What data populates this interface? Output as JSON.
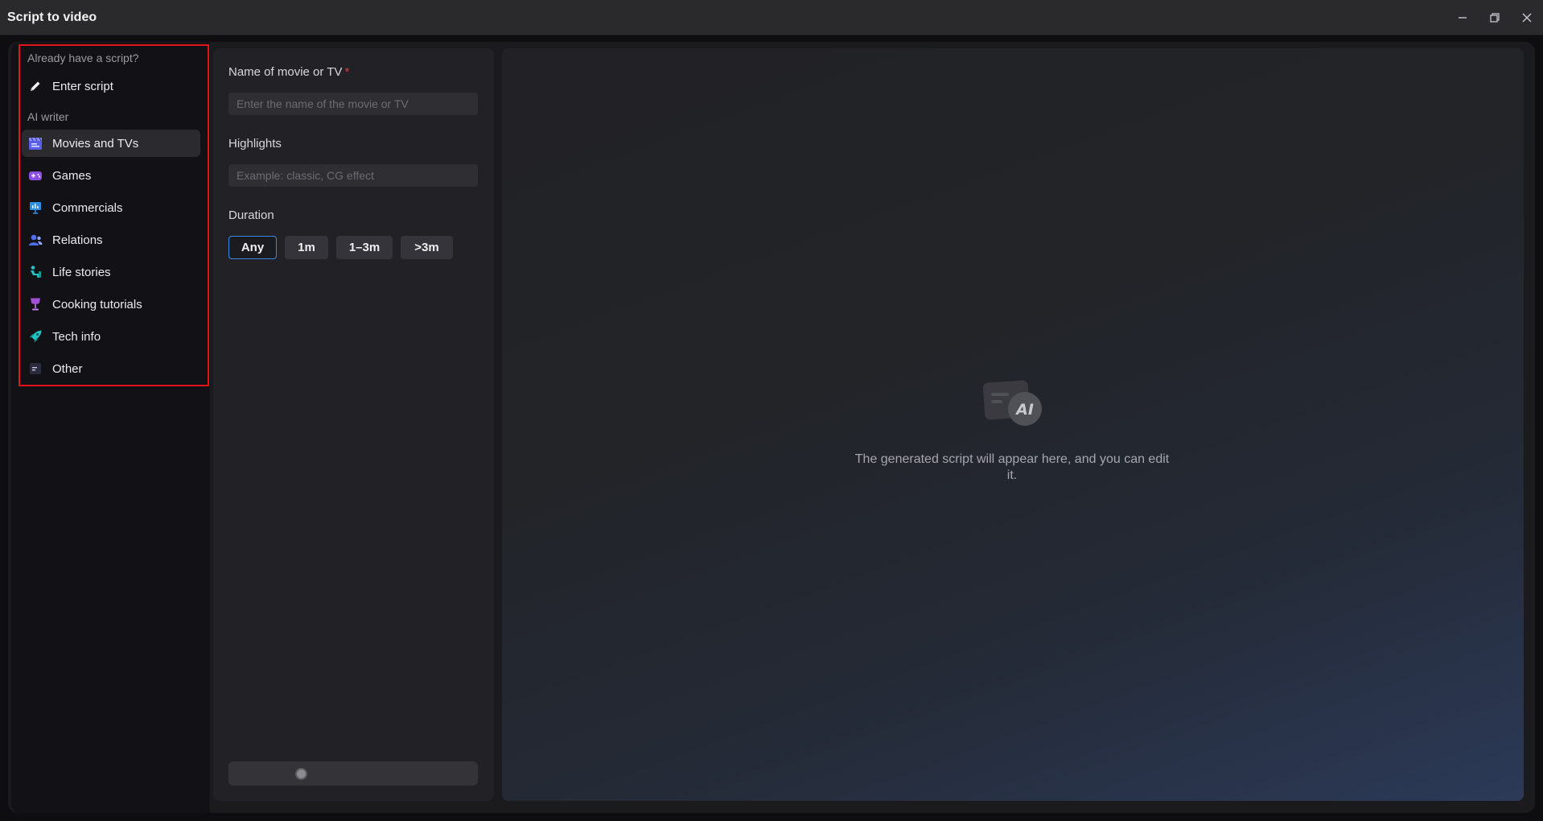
{
  "window": {
    "title": "Script to video",
    "controls": [
      "minimize-icon",
      "restore-icon",
      "close-icon"
    ]
  },
  "sidebar": {
    "section_existing": "Already have a script?",
    "enter_script": {
      "label": "Enter script",
      "icon": "pencil-icon"
    },
    "section_ai": "AI writer",
    "items": [
      {
        "label": "Movies and TVs",
        "icon": "clapperboard-icon",
        "active": true
      },
      {
        "label": "Games",
        "icon": "gamepad-icon",
        "active": false
      },
      {
        "label": "Commercials",
        "icon": "billboard-icon",
        "active": false
      },
      {
        "label": "Relations",
        "icon": "people-icon",
        "active": false
      },
      {
        "label": "Life stories",
        "icon": "person-seated-icon",
        "active": false
      },
      {
        "label": "Cooking tutorials",
        "icon": "goblet-icon",
        "active": false
      },
      {
        "label": "Tech info",
        "icon": "rocket-icon",
        "active": false
      },
      {
        "label": "Other",
        "icon": "document-icon",
        "active": false
      }
    ]
  },
  "form": {
    "name_label": "Name of movie or TV",
    "required_mark": "*",
    "name_placeholder": "Enter the name of the movie or TV",
    "highlights_label": "Highlights",
    "highlights_placeholder": "Example: classic, CG effect",
    "duration_label": "Duration",
    "durations": [
      "Any",
      "1m",
      "1–3m",
      ">3m"
    ],
    "selected_duration": "Any"
  },
  "preview": {
    "icon": "ai-script-icon",
    "message": "The generated script will appear here, and you can edit it."
  },
  "colors": {
    "accent": "#3a86e4",
    "highlight_box": "#e3121b",
    "required": "#e03a3a"
  }
}
